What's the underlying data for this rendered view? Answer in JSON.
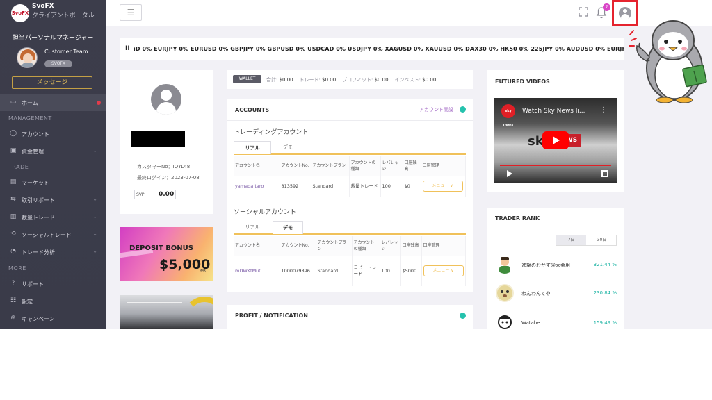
{
  "sidebar": {
    "logo": "SvoFX",
    "title": "SvoFX",
    "subtitle": "クライアントポータル",
    "pm_label": "担当パーソナルマネージャー",
    "manager_name": "Customer Team",
    "manager_badge": "SVOFX",
    "message_button": "メッセージ",
    "sections": {
      "management": "MANAGEMENT",
      "trade": "TRADE",
      "more": "MORE"
    },
    "items": [
      {
        "label": "ホーム",
        "icon": "monitor-icon"
      },
      {
        "label": "アカウント",
        "icon": "user-icon"
      },
      {
        "label": "資金管理",
        "icon": "wallet-icon"
      },
      {
        "label": "マーケット",
        "icon": "chart-icon"
      },
      {
        "label": "取引リポート",
        "icon": "report-icon"
      },
      {
        "label": "裁量トレード",
        "icon": "trade-icon"
      },
      {
        "label": "ソーシャルトレード",
        "icon": "social-icon"
      },
      {
        "label": "トレード分析",
        "icon": "analysis-icon"
      },
      {
        "label": "サポート",
        "icon": "help-icon"
      },
      {
        "label": "設定",
        "icon": "settings-icon"
      },
      {
        "label": "キャンペーン",
        "icon": "campaign-icon"
      }
    ]
  },
  "topbar": {
    "menu_glyph": "☰",
    "notification_count": "7"
  },
  "ticker": {
    "lead": "II",
    "text": "iD 0%  EURJPY 0%  EURUSD 0%  GBPJPY 0%  GBPUSD 0%  USDCAD 0%  USDJPY 0%  XAGUSD 0%  XAUUSD 0%  DAX30 0%  HK50 0%  225JPY 0%  AUDUSD 0%  EURJF"
  },
  "profile": {
    "customer_no": "カスタマーNo：IQYL48",
    "last_login": "最終ログイン：2023-07-08",
    "svp_label": "SVP",
    "svp_value": "0.00"
  },
  "banner": {
    "title": "DEPOSIT BONUS",
    "amount": "$5,000",
    "max": "MAX"
  },
  "wallet": {
    "tag": "WALLET",
    "total_label": "合計:",
    "total": "$0.00",
    "trade_label": "トレード:",
    "trade": "$0.00",
    "profit_label": "プロフィット:",
    "profit": "$0.00",
    "invest_label": "インベスト:",
    "invest": "$0.00"
  },
  "accounts": {
    "title": "ACCOUNTS",
    "open_account": "アカウント開設",
    "trading_title": "トレーディングアカウント",
    "social_title": "ソーシャルアカウント",
    "tab_real": "リアル",
    "tab_demo": "デモ",
    "headers": [
      "アカウント名",
      "アカウントNo.",
      "アカウントプラン",
      "アカウントの種類",
      "レバレッジ",
      "口座残高",
      "口座管理"
    ],
    "trading_row": [
      "yamada taro",
      "813592",
      "Standard",
      "裁量トレード",
      "100",
      "$0",
      "メニュー ∨"
    ],
    "social_row": [
      "mDWKtMu0",
      "1000079896",
      "Standard",
      "コピートレード",
      "100",
      "$5000",
      "メニュー ∨"
    ]
  },
  "profit_card": {
    "title": "PROFIT / NOTIFICATION"
  },
  "videos": {
    "title": "FUTURED VIDEOS",
    "video_title": "Watch Sky News li...",
    "channel": "sky news",
    "brand_left": "sk",
    "brand_right": "WS"
  },
  "rank": {
    "title": "TRADER RANK",
    "tab_7": "7日",
    "tab_30": "30日",
    "rows": [
      {
        "name": "進撃のおかず@大会用",
        "pct": "321.44 %"
      },
      {
        "name": "わんわんてや",
        "pct": "230.84 %"
      },
      {
        "name": "Watabe",
        "pct": "159.49 %"
      }
    ]
  },
  "colors": {
    "sidebar": "#3c3d4b",
    "accent": "#f0c15a",
    "teal": "#25c2ad",
    "highlight": "#e5232e"
  }
}
